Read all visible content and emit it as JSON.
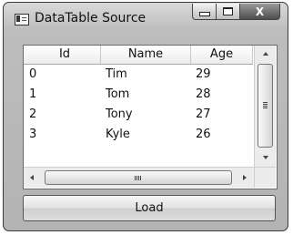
{
  "window": {
    "title": "DataTable Source",
    "icons": {
      "app": "window-app-icon",
      "minimize": "minimize-icon",
      "maximize": "maximize-icon",
      "close": "close-icon"
    },
    "close_glyph": "X"
  },
  "grid": {
    "columns": [
      "Id",
      "Name",
      "Age"
    ],
    "rows": [
      {
        "id": "0",
        "name": "Tim",
        "age": "29"
      },
      {
        "id": "1",
        "name": "Tom",
        "age": "28"
      },
      {
        "id": "2",
        "name": "Tony",
        "age": "27"
      },
      {
        "id": "3",
        "name": "Kyle",
        "age": "26"
      }
    ]
  },
  "load_button": {
    "label": "Load"
  }
}
